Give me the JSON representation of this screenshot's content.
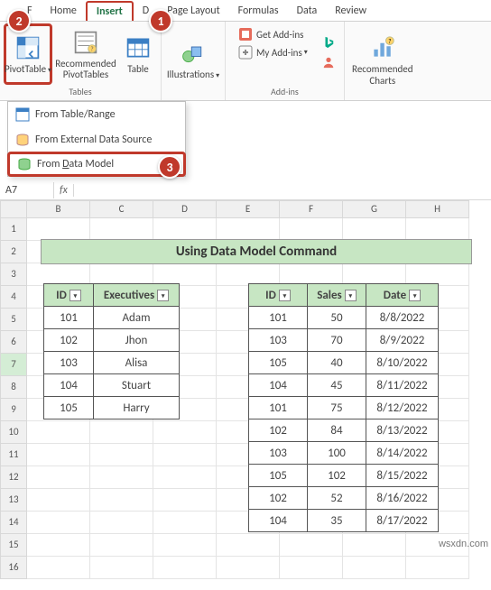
{
  "tabs": {
    "file": "F",
    "home": "Home",
    "insert": "Insert",
    "draw": "D",
    "page_layout": "Page Layout",
    "formulas": "Formulas",
    "data": "Data",
    "review": "Review"
  },
  "ribbon": {
    "pivottable": {
      "label": "PivotTable",
      "caption": "Tables"
    },
    "rec_pivot": "Recommended\nPivotTables",
    "table": "Table",
    "illustrations": "Illustrations",
    "get_addins": "Get Add-ins",
    "my_addins": "My Add-ins",
    "addins_caption": "Add-ins",
    "rec_charts": "Recommended\nCharts"
  },
  "dropdown": {
    "i1": "From Table/Range",
    "i2": "From External Data Source",
    "i3_pre": "From ",
    "i3_u": "D",
    "i3_post": "ata Model"
  },
  "formula": {
    "namebox": "A7",
    "fx": "fx"
  },
  "cols": [
    "B",
    "C",
    "D",
    "E",
    "F",
    "G",
    "H"
  ],
  "title_band": "Using Data Model Command",
  "table1": {
    "headers": [
      "ID",
      "Executives"
    ],
    "rows": [
      [
        "101",
        "Adam"
      ],
      [
        "102",
        "Jhon"
      ],
      [
        "103",
        "Alisa"
      ],
      [
        "104",
        "Stuart"
      ],
      [
        "105",
        "Harry"
      ]
    ]
  },
  "table2": {
    "headers": [
      "ID",
      "Sales",
      "Date"
    ],
    "rows": [
      [
        "101",
        "50",
        "8/8/2022"
      ],
      [
        "103",
        "70",
        "8/9/2022"
      ],
      [
        "105",
        "40",
        "8/10/2022"
      ],
      [
        "104",
        "45",
        "8/11/2022"
      ],
      [
        "101",
        "75",
        "8/12/2022"
      ],
      [
        "102",
        "84",
        "8/13/2022"
      ],
      [
        "103",
        "100",
        "8/14/2022"
      ],
      [
        "105",
        "102",
        "8/15/2022"
      ],
      [
        "102",
        "52",
        "8/16/2022"
      ],
      [
        "104",
        "35",
        "8/17/2022"
      ]
    ]
  },
  "rownums": [
    "1",
    "2",
    "3",
    "4",
    "5",
    "6",
    "7",
    "8",
    "9",
    "10",
    "11",
    "12",
    "13",
    "14",
    "15",
    "16"
  ],
  "callouts": {
    "c1": "1",
    "c2": "2",
    "c3": "3"
  },
  "watermark": "wsxdn.com"
}
